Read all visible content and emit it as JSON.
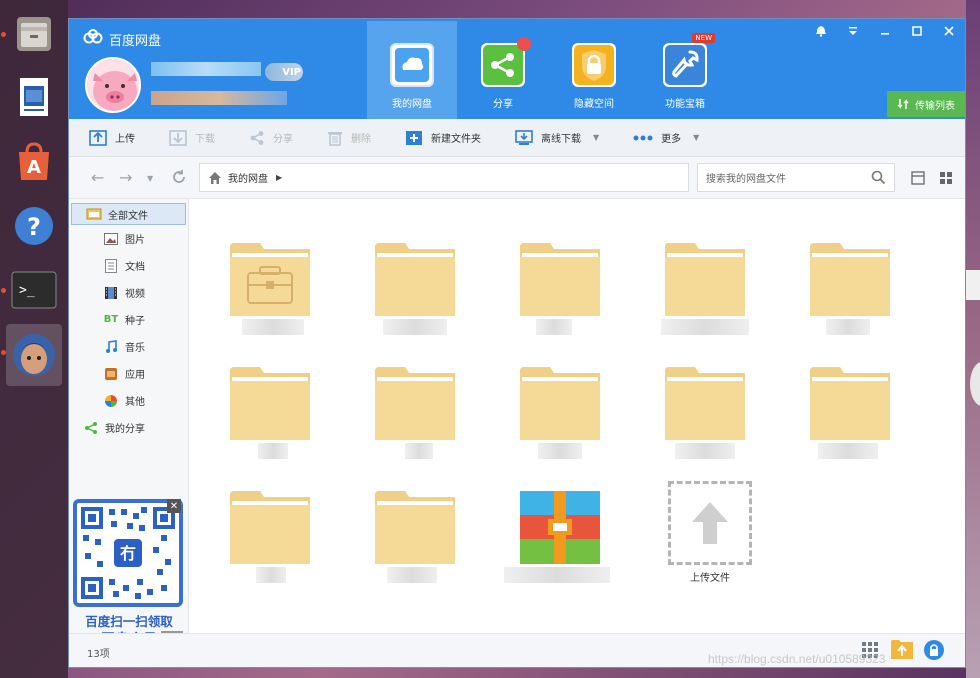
{
  "app": {
    "title": "百度网盘"
  },
  "colors": {
    "accent": "#2e8ae6",
    "transfer": "#59b84f",
    "folder": "#f5d997"
  },
  "launcher": {
    "items": [
      "files-icon",
      "document-viewer-icon",
      "software-center-icon",
      "help-icon",
      "terminal-icon",
      "game-avatar-icon"
    ]
  },
  "user": {
    "vip_label": "VIP"
  },
  "nav": {
    "tabs": [
      {
        "label": "我的网盘",
        "icon": "cloud-icon"
      },
      {
        "label": "分享",
        "icon": "share-icon"
      },
      {
        "label": "隐藏空间",
        "icon": "lock-icon"
      },
      {
        "label": "功能宝箱",
        "icon": "wrench-icon",
        "badge": "NEW"
      }
    ]
  },
  "transfer_label": "传输列表",
  "toolbar": {
    "upload": "上传",
    "download": "下载",
    "share": "分享",
    "delete": "删除",
    "new_folder": "新建文件夹",
    "offline_download": "离线下载",
    "more": "更多"
  },
  "address": {
    "breadcrumb": "我的网盘",
    "search_placeholder": "搜索我的网盘文件"
  },
  "sidebar": {
    "items": [
      {
        "label": "全部文件",
        "icon": "all-files-icon"
      },
      {
        "label": "图片",
        "icon": "image-icon"
      },
      {
        "label": "文档",
        "icon": "document-icon"
      },
      {
        "label": "视频",
        "icon": "video-icon"
      },
      {
        "label": "种子",
        "icon": "bt-icon"
      },
      {
        "label": "音乐",
        "icon": "music-icon"
      },
      {
        "label": "应用",
        "icon": "app-icon"
      },
      {
        "label": "其他",
        "icon": "other-icon"
      },
      {
        "label": "我的分享",
        "icon": "my-share-icon"
      }
    ],
    "promo_line1": "百度扫一扫领取",
    "promo_line2": "网盘会员",
    "ad_tag": "告"
  },
  "files": {
    "upload_label": "上传文件"
  },
  "status": {
    "count": "13项"
  },
  "watermark": "https://blog.csdn.net/u010589323"
}
